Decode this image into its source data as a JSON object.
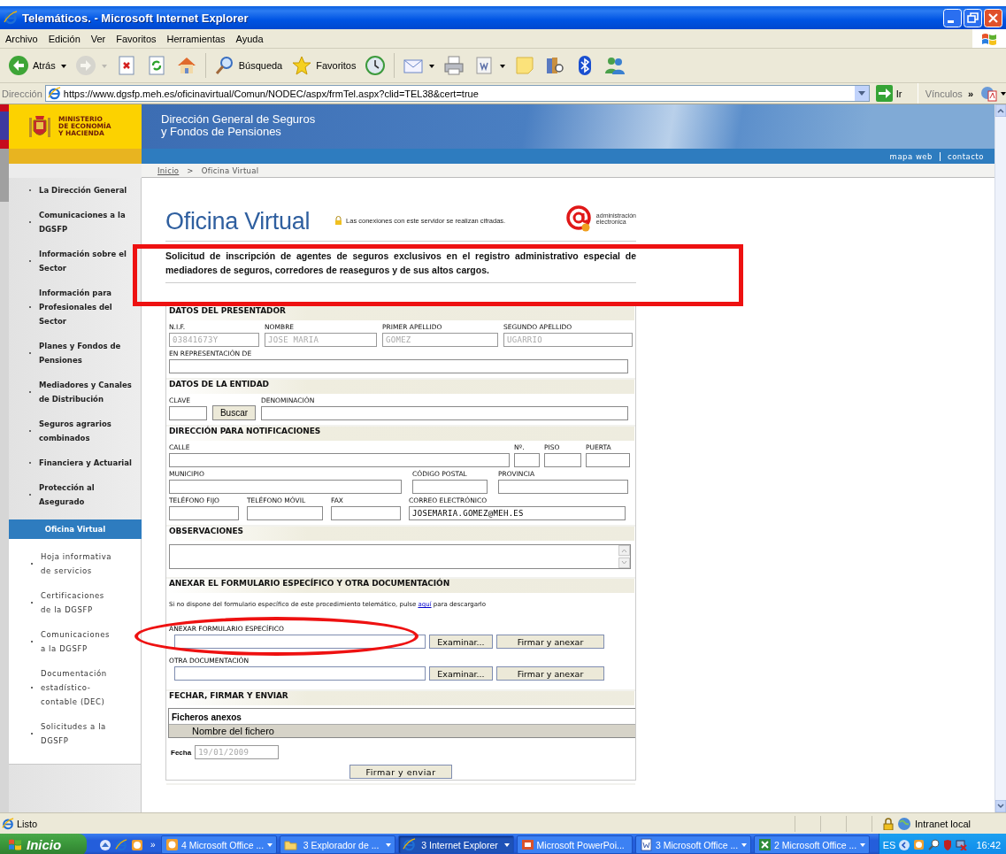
{
  "window": {
    "title": "Telemáticos. - Microsoft Internet Explorer"
  },
  "menu": [
    "Archivo",
    "Edición",
    "Ver",
    "Favoritos",
    "Herramientas",
    "Ayuda"
  ],
  "toolbar": [
    {
      "label": "Atrás",
      "dropdown": true,
      "disabled": false
    },
    {
      "dropdown": true,
      "disabled": true
    },
    {
      "disabled": false
    },
    {
      "disabled": false
    },
    {
      "disabled": false
    },
    {
      "label": "Búsqueda",
      "disabled": false
    },
    {
      "label": "Favoritos",
      "disabled": false
    },
    {
      "disabled": false
    },
    {
      "dropdown": true,
      "disabled": false
    },
    {
      "disabled": false
    },
    {
      "dropdown": true,
      "disabled": false
    },
    {
      "disabled": false
    },
    {
      "disabled": false
    },
    {
      "disabled": false
    },
    {
      "disabled": false
    }
  ],
  "address": {
    "label": "Dirección",
    "url": "https://www.dgsfp.meh.es/oficinavirtual/Comun/NODEC/aspx/frmTel.aspx?clid=TEL38&cert=true",
    "go": "Ir",
    "links": "Vínculos",
    "chevron": "»"
  },
  "site": {
    "ministry": "MINISTERIO\nDE ECONOMÍA\nY HACIENDA",
    "agency": "Dirección General de Seguros\ny Fondos de Pensiones",
    "top_links": [
      "mapa web",
      "contacto"
    ],
    "breadcrumb": {
      "items": [
        "Inicio",
        "Oficina Virtual"
      ],
      "separator": ">"
    },
    "sidebar": {
      "items": [
        {
          "label": "La Dirección General",
          "selected": false
        },
        {
          "label": "Comunicaciones a la\nDGSFP",
          "selected": false
        },
        {
          "label": "Información sobre el\nSector",
          "selected": false
        },
        {
          "label": "Información para\nProfesionales del\nSector",
          "selected": false
        },
        {
          "label": "Planes y Fondos de\nPensiones",
          "selected": false
        },
        {
          "label": "Mediadores y Canales\nde Distribución",
          "selected": false
        },
        {
          "label": "Seguros agrarios\ncombinados",
          "selected": false
        },
        {
          "label": "Financiera y Actuarial",
          "selected": false
        },
        {
          "label": "Protección al\nAsegurado",
          "selected": false
        },
        {
          "label": "Oficina Virtual",
          "selected": true,
          "children": [
            {
              "label": "Hoja informativa\nde servicios",
              "selected": false
            },
            {
              "label": "Certificaciones\nde la DGSFP",
              "selected": false
            },
            {
              "label": "Comunicaciones\na la DGSFP",
              "selected": false
            },
            {
              "label": "Documentación\nestadístico-\ncontable (DEC)",
              "selected": false
            },
            {
              "label": "Solicitudes a la\nDGSFP",
              "selected": false
            }
          ]
        }
      ]
    },
    "page_title": "Oficina Virtual",
    "secure_note": "Las conexiones con este servidor se realizan cifradas.",
    "logo_text": "administración\nelectronica",
    "description": "Solicitud de inscripción de agentes de seguros exclusivos en el registro administrativo especial de mediadores de seguros, corredores de reaseguros y de sus altos cargos.",
    "form": {
      "sections": [
        {
          "title": "DATOS DEL PRESENTADOR",
          "kind": "fields",
          "lines": [
            {
              "fields": [
                {
                  "kind": "text",
                  "label": "N.I.F.",
                  "value": "03841673Y",
                  "disabled": true
                },
                {
                  "kind": "text",
                  "label": "NOMBRE",
                  "value": "JOSE MARIA",
                  "disabled": true
                },
                {
                  "kind": "text",
                  "label": "PRIMER APELLIDO",
                  "value": "GOMEZ",
                  "disabled": true
                },
                {
                  "kind": "text",
                  "label": "SEGUNDO APELLIDO",
                  "value": "UGARRIO",
                  "disabled": true
                }
              ]
            },
            {
              "fields": [
                {
                  "kind": "text",
                  "label": "EN REPRESENTACIÓN DE",
                  "disabled": false
                }
              ]
            }
          ]
        },
        {
          "title": "DATOS DE LA ENTIDAD",
          "kind": "fields",
          "lines": [
            {
              "fields": [
                {
                  "kind": "text",
                  "label": "CLAVE",
                  "disabled": false
                },
                {
                  "kind": "button",
                  "label": "Buscar"
                },
                {
                  "kind": "text",
                  "label": "DENOMINACIÓN",
                  "disabled": false
                }
              ]
            }
          ]
        },
        {
          "title": "DIRECCIÓN PARA NOTIFICACIONES",
          "kind": "fields",
          "lines": [
            {
              "fields": [
                {
                  "kind": "text",
                  "label": "CALLE",
                  "disabled": false
                },
                {
                  "kind": "text",
                  "label": "Nº.",
                  "disabled": false
                },
                {
                  "kind": "text",
                  "label": "PISO",
                  "disabled": false
                },
                {
                  "kind": "text",
                  "label": "PUERTA",
                  "disabled": false
                }
              ]
            },
            {
              "fields": [
                {
                  "kind": "text",
                  "label": "MUNICIPIO",
                  "disabled": false
                },
                {
                  "kind": "text",
                  "label": "CÓDIGO POSTAL",
                  "disabled": false
                },
                {
                  "kind": "text",
                  "label": "PROVINCIA",
                  "disabled": false
                }
              ]
            },
            {
              "fields": [
                {
                  "kind": "text",
                  "label": "TELÉFONO FIJO",
                  "disabled": false
                },
                {
                  "kind": "text",
                  "label": "TELÉFONO MÓVIL",
                  "disabled": false
                },
                {
                  "kind": "text",
                  "label": "FAX",
                  "disabled": false
                },
                {
                  "kind": "text",
                  "label": "CORREO ELECTRÓNICO",
                  "value": "JOSEMARIA.GOMEZ@MEH.ES",
                  "disabled": false
                }
              ]
            }
          ]
        },
        {
          "title": "OBSERVACIONES",
          "kind": "textarea"
        },
        {
          "title": "ANEXAR EL FORMULARIO ESPECÍFICO Y OTRA DOCUMENTACIÓN",
          "kind": "attach",
          "note": {
            "before": "Si no dispone del formulario específico de este procedimiento telemático, pulse ",
            "link": "aquí",
            "after": " para descargarlo"
          },
          "attachments": [
            {
              "label": "ANEXAR FORMULARIO ESPECÍFICO",
              "browse": "Examinar...",
              "sign": "Firmar y anexar"
            },
            {
              "label": "OTRA DOCUMENTACIÓN",
              "browse": "Examinar...",
              "sign": "Firmar y anexar"
            }
          ]
        },
        {
          "title": "FECHAR, FIRMAR Y ENVIAR",
          "kind": "submit",
          "files": {
            "title": "Ficheros anexos",
            "column": "Nombre del fichero"
          },
          "date": {
            "label": "Fecha",
            "value": "19/01/2009",
            "disabled": true
          },
          "button": "Firmar y enviar"
        }
      ]
    }
  },
  "status_bar": {
    "text": "Listo",
    "zone": "Intranet local"
  },
  "taskbar": {
    "start": "Inicio",
    "chevron": "»",
    "tasks": [
      {
        "label": "4 Microsoft Office ...",
        "grouped": true,
        "selected": false
      },
      {
        "label": "3 Explorador de ...",
        "grouped": true,
        "selected": false
      },
      {
        "label": "3 Internet Explorer",
        "grouped": true,
        "selected": true
      },
      {
        "label": "Microsoft PowerPoi...",
        "grouped": false,
        "selected": false
      },
      {
        "label": "3 Microsoft Office ...",
        "grouped": true,
        "selected": false
      },
      {
        "label": "2 Microsoft Office ...",
        "grouped": true,
        "selected": false
      }
    ],
    "language": "ES",
    "clock": "16:42"
  }
}
